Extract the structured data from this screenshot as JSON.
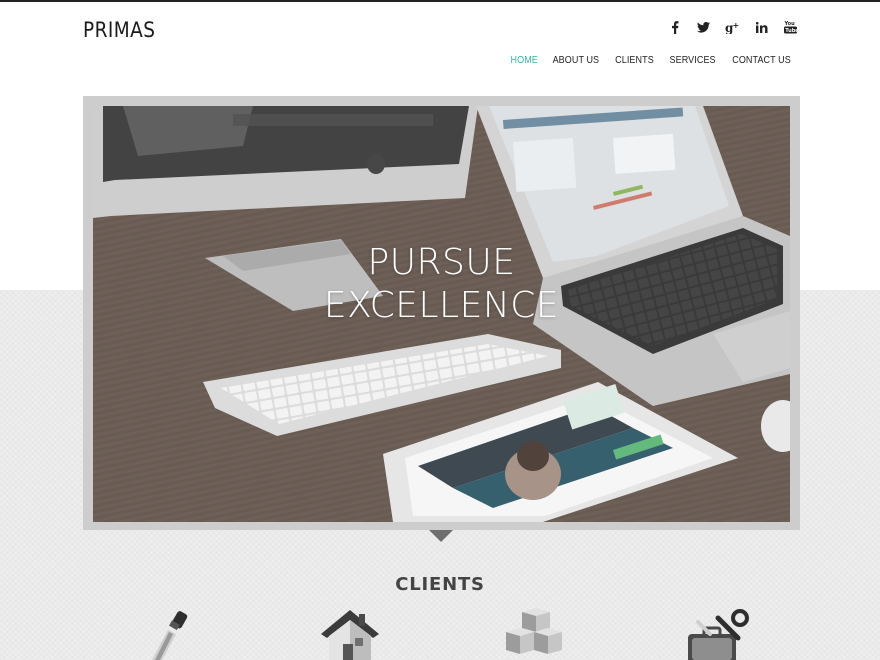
{
  "header": {
    "logo": "PRIMAS"
  },
  "social": [
    {
      "name": "facebook-icon",
      "glyph": "f"
    },
    {
      "name": "twitter-icon",
      "glyph": "t"
    },
    {
      "name": "google-plus-icon",
      "glyph": "g+"
    },
    {
      "name": "linkedin-icon",
      "glyph": "in"
    },
    {
      "name": "youtube-icon",
      "glyph": "yt"
    }
  ],
  "nav": {
    "items": [
      {
        "label": "HOME",
        "active": true
      },
      {
        "label": "ABOUT US",
        "active": false
      },
      {
        "label": "CLIENTS",
        "active": false
      },
      {
        "label": "SERVICES",
        "active": false
      },
      {
        "label": "CONTACT US",
        "active": false
      }
    ]
  },
  "hero": {
    "line1": "PURSUE",
    "line2": "EXCELLENCE"
  },
  "clients": {
    "heading": "CLIENTS",
    "icons": [
      "dropper-icon",
      "house-icon",
      "cubes-icon",
      "tools-icon"
    ]
  },
  "colors": {
    "accent": "#35b7a3",
    "text": "#222222",
    "pattern": "#efefef"
  }
}
